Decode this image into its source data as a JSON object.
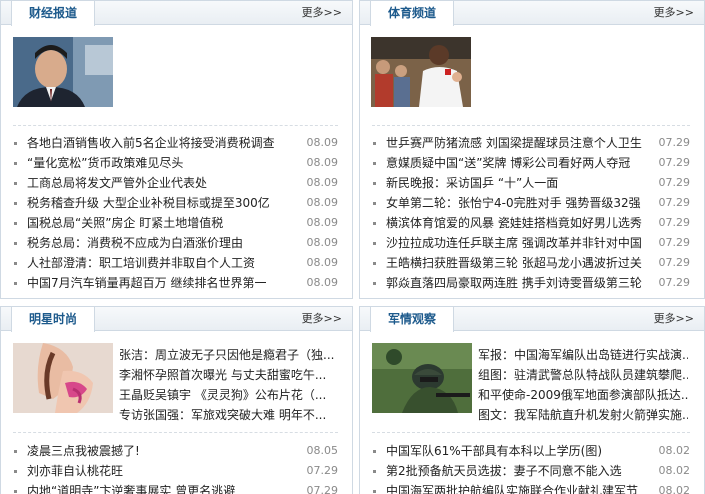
{
  "finance": {
    "title": "财经报道",
    "more": "更多>>",
    "list": [
      {
        "title": "各地白酒销售收入前5名企业将接受消费税调查",
        "date": "08.09"
      },
      {
        "title": "“量化宽松”货币政策难见尽头",
        "date": "08.09"
      },
      {
        "title": "工商总局将发文严管外企业代表处",
        "date": "08.09"
      },
      {
        "title": "税务稽查升级 大型企业补税目标或提至300亿",
        "date": "08.09"
      },
      {
        "title": "国税总局“关照”房企 盯紧土地增值税",
        "date": "08.09"
      },
      {
        "title": "税务总局：消费税不应成为白酒涨价理由",
        "date": "08.09"
      },
      {
        "title": "人社部澄清：职工培训费并非取自个人工资",
        "date": "08.09"
      },
      {
        "title": "中国7月汽车销量再超百万 继续排名世界第一",
        "date": "08.09"
      }
    ]
  },
  "sports": {
    "title": "体育频道",
    "more": "更多>>",
    "list": [
      {
        "title": "世乒赛严防猪流感 刘国梁提醒球员注意个人卫生",
        "date": "07.29"
      },
      {
        "title": "意媒质疑中国“送”奖牌 博彩公司看好两人夺冠",
        "date": "07.29"
      },
      {
        "title": "新民晚报：采访国乒 “十”人一面",
        "date": "07.29"
      },
      {
        "title": "女单第二轮：张怡宁4-0完胜对手 强势晋级32强",
        "date": "07.29"
      },
      {
        "title": "横滨体育馆爱的风暴 瓷娃娃搭档竟如好男儿选秀",
        "date": "07.29"
      },
      {
        "title": "沙拉拉成功连任乒联主席 强调改革并非针对中国",
        "date": "07.29"
      },
      {
        "title": "王皓横扫获胜晋级第三轮 张超马龙小遇波折过关",
        "date": "07.29"
      },
      {
        "title": "郭焱直落四局豪取两连胜 携手刘诗雯晋级第三轮",
        "date": "07.29"
      }
    ]
  },
  "stars": {
    "title": "明星时尚",
    "more": "更多>>",
    "top": [
      "张洁：周立波无子只因他是瘾君子（独...",
      "李湘怀孕照首次曝光 与丈夫甜蜜吃午...",
      "王晶贬吴镇宇 《灵灵狗》公布片花（...",
      "专访张国强：军旅戏突破大难 明年不..."
    ],
    "list": [
      {
        "title": "凌晨三点我被震撼了!",
        "date": "08.05"
      },
      {
        "title": "刘亦菲自认桃花旺",
        "date": "07.29"
      },
      {
        "title": "内地“道明寺”卞逆奢事展实 曾更名逃避",
        "date": "07.29"
      }
    ]
  },
  "military": {
    "title": "军情观察",
    "more": "更多>>",
    "top": [
      "军报：中国海军编队出岛链进行实战演...",
      "组图：驻清武警总队特战队员建筑攀爬...",
      "和平使命-2009俄军地面参演部队抵达...",
      "图文：我军陆航直升机发射火箭弹实施..."
    ],
    "list": [
      {
        "title": "中国军队61%干部具有本科以上学历(图)",
        "date": "08.02"
      },
      {
        "title": "第2批预备航天员选拔：妻子不同意不能入选",
        "date": "08.02"
      },
      {
        "title": "中国海军两批护航编队实施联合作业献礼建军节",
        "date": "08.02"
      }
    ]
  }
}
